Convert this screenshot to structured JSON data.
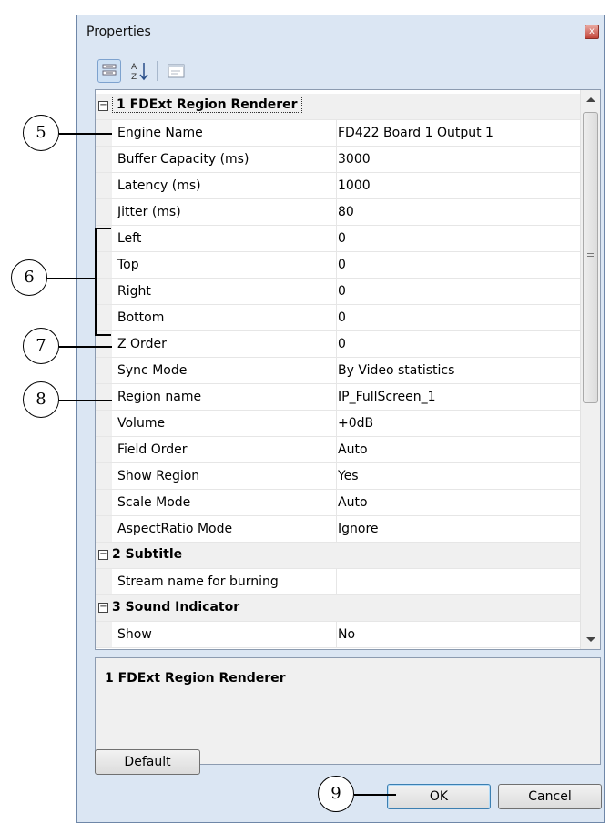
{
  "window": {
    "title": "Properties",
    "close_glyph": "x"
  },
  "toolbar": {
    "categorized_icon": "categorized-icon",
    "alphabetical_icon": "sort-az-icon",
    "alphabetical_glyph": "A↓Z",
    "property_pages_icon": "property-pages-icon"
  },
  "grid": {
    "rows": [
      {
        "type": "category",
        "expander": "−",
        "name": "1 FDExt Region Renderer"
      },
      {
        "type": "property",
        "name": "Engine Name",
        "value": "FD422 Board 1 Output 1"
      },
      {
        "type": "property",
        "name": "Buffer Capacity (ms)",
        "value": "3000"
      },
      {
        "type": "property",
        "name": "Latency (ms)",
        "value": "1000"
      },
      {
        "type": "property",
        "name": "Jitter (ms)",
        "value": "80"
      },
      {
        "type": "property",
        "name": "Left",
        "value": "0"
      },
      {
        "type": "property",
        "name": "Top",
        "value": "0"
      },
      {
        "type": "property",
        "name": "Right",
        "value": "0"
      },
      {
        "type": "property",
        "name": "Bottom",
        "value": "0"
      },
      {
        "type": "property",
        "name": "Z Order",
        "value": "0"
      },
      {
        "type": "property",
        "name": "Sync Mode",
        "value": "By Video statistics"
      },
      {
        "type": "property",
        "name": "Region name",
        "value": "IP_FullScreen_1"
      },
      {
        "type": "property",
        "name": "Volume",
        "value": "+0dB"
      },
      {
        "type": "property",
        "name": "Field Order",
        "value": "Auto"
      },
      {
        "type": "property",
        "name": "Show Region",
        "value": "Yes"
      },
      {
        "type": "property",
        "name": "Scale Mode",
        "value": "Auto"
      },
      {
        "type": "property",
        "name": "AspectRatio Mode",
        "value": "Ignore"
      },
      {
        "type": "category",
        "expander": "−",
        "name": "2 Subtitle"
      },
      {
        "type": "property",
        "name": "Stream name for burning",
        "value": ""
      },
      {
        "type": "category",
        "expander": "−",
        "name": "3 Sound Indicator"
      },
      {
        "type": "property",
        "name": "Show",
        "value": "No"
      }
    ]
  },
  "description": {
    "title": "1 FDExt Region Renderer"
  },
  "buttons": {
    "default": "Default",
    "ok": "OK",
    "cancel": "Cancel"
  },
  "callouts": {
    "c5": "5",
    "c6": "6",
    "c7": "7",
    "c8": "8",
    "c9": "9"
  }
}
